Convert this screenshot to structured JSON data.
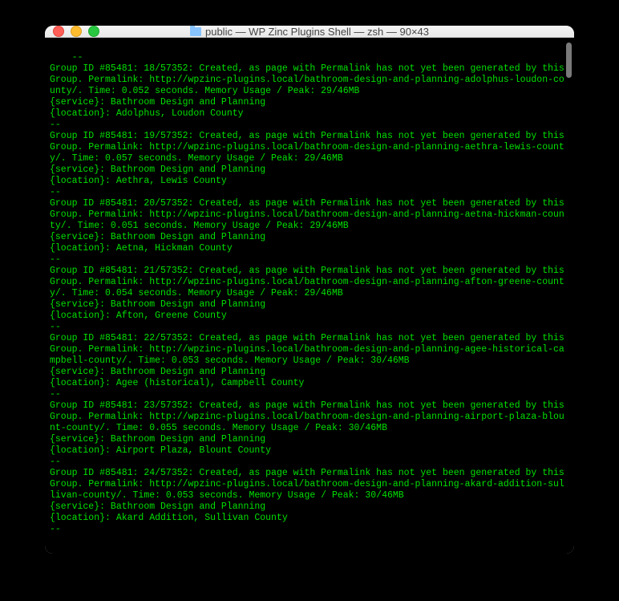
{
  "title": "public — WP Zinc Plugins Shell — zsh — 90×43",
  "group_id": "#85481",
  "total": "57352",
  "common": {
    "created_msg": "Created, as page with Permalink has not yet been generated by this Group. Permalink:",
    "time_label": "Time:",
    "mem_label": "Memory Usage / Peak:",
    "service_label": "{service}:",
    "location_label": "{location}:",
    "service": "Bathroom Design and Planning",
    "sep": "--"
  },
  "entries": [
    {
      "n": "18",
      "permalink": "http://wpzinc-plugins.local/bathroom-design-and-planning-adolphus-loudon-county/",
      "time": "0.052 seconds.",
      "mem": "29/46MB",
      "location": "Adolphus, Loudon County"
    },
    {
      "n": "19",
      "permalink": "http://wpzinc-plugins.local/bathroom-design-and-planning-aethra-lewis-county/",
      "time": "0.057 seconds.",
      "mem": "29/46MB",
      "location": "Aethra, Lewis County"
    },
    {
      "n": "20",
      "permalink": "http://wpzinc-plugins.local/bathroom-design-and-planning-aetna-hickman-county/",
      "time": "0.051 seconds.",
      "mem": "29/46MB",
      "location": "Aetna, Hickman County"
    },
    {
      "n": "21",
      "permalink": "http://wpzinc-plugins.local/bathroom-design-and-planning-afton-greene-county/",
      "time": "0.054 seconds.",
      "mem": "29/46MB",
      "location": "Afton, Greene County"
    },
    {
      "n": "22",
      "permalink": "http://wpzinc-plugins.local/bathroom-design-and-planning-agee-historical-campbell-county/",
      "time": "0.053 seconds.",
      "mem": "30/46MB",
      "location": "Agee (historical), Campbell County"
    },
    {
      "n": "23",
      "permalink": "http://wpzinc-plugins.local/bathroom-design-and-planning-airport-plaza-blount-county/",
      "time": "0.055 seconds.",
      "mem": "30/46MB",
      "location": "Airport Plaza, Blount County"
    },
    {
      "n": "24",
      "permalink": "http://wpzinc-plugins.local/bathroom-design-and-planning-akard-addition-sullivan-county/",
      "time": "0.053 seconds.",
      "mem": "30/46MB",
      "location": "Akard Addition, Sullivan County"
    }
  ]
}
